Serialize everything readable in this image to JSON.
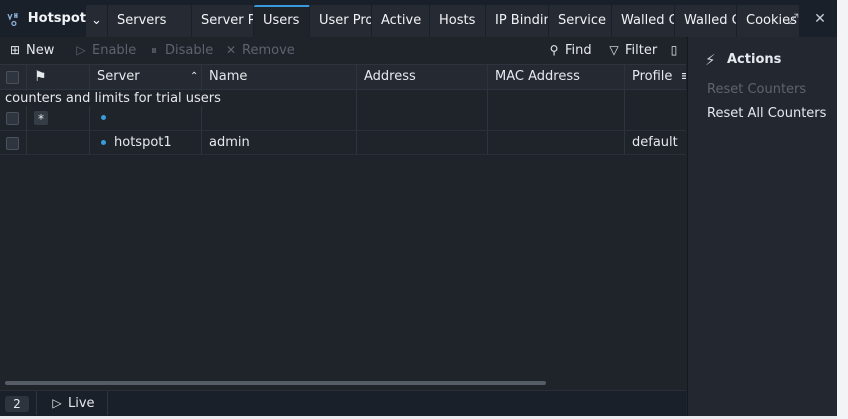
{
  "app": {
    "title": "Hotspot"
  },
  "tabs": [
    {
      "label": "Servers"
    },
    {
      "label": "Server P"
    },
    {
      "label": "Users"
    },
    {
      "label": "User Pro"
    },
    {
      "label": "Active"
    },
    {
      "label": "Hosts"
    },
    {
      "label": "IP Bindin"
    },
    {
      "label": "Service I"
    },
    {
      "label": "Walled G"
    },
    {
      "label": "Walled G"
    },
    {
      "label": "Cookies"
    }
  ],
  "toolbar": {
    "new_label": "New",
    "enable_label": "Enable",
    "disable_label": "Disable",
    "remove_label": "Remove",
    "find_label": "Find",
    "filter_label": "Filter"
  },
  "table": {
    "columns": [
      "Server",
      "Name",
      "Address",
      "MAC Address",
      "Profile"
    ],
    "comment": "counters and limits for trial users",
    "rows": [
      {
        "flag": "*",
        "server": "",
        "name": "",
        "address": "",
        "mac": "",
        "profile": ""
      },
      {
        "flag": "",
        "server": "hotspot1",
        "name": "admin",
        "address": "",
        "mac": "",
        "profile": "default"
      }
    ]
  },
  "status": {
    "count": "2",
    "live_label": "Live"
  },
  "actions": {
    "title": "Actions",
    "reset_counters": "Reset Counters",
    "reset_all_counters": "Reset All Counters"
  },
  "colors": {
    "accent": "#3a9bdc",
    "background": "#1f232a",
    "disabled_text": "#5d646f"
  }
}
